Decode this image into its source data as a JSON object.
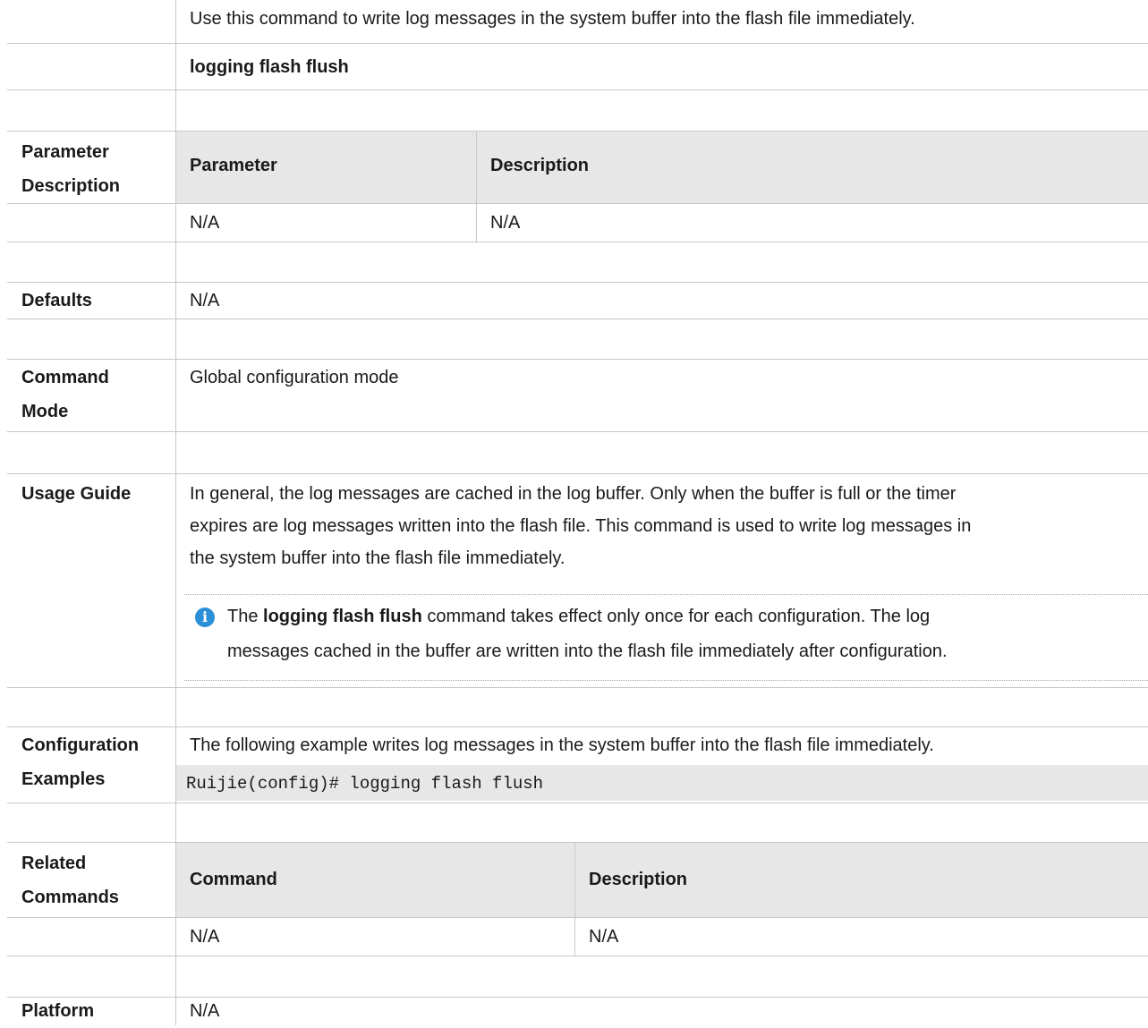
{
  "summary": {
    "description": "Use this command to write log messages in the system buffer into the flash file immediately.",
    "command": "logging flash flush"
  },
  "parameter_description": {
    "label": [
      "Parameter",
      "Description"
    ],
    "headers": [
      "Parameter",
      "Description"
    ],
    "rows": [
      [
        "N/A",
        "N/A"
      ]
    ]
  },
  "defaults": {
    "label": "Defaults",
    "value": "N/A"
  },
  "command_mode": {
    "label": [
      "Command",
      "Mode"
    ],
    "value": "Global configuration mode"
  },
  "usage_guide": {
    "label": "Usage Guide",
    "lines": [
      "In general, the log messages are cached in the log buffer. Only when the buffer is full or the timer",
      "expires are log messages written into the flash file. This command is used to write log messages in",
      "the system buffer into the flash file immediately."
    ],
    "note": {
      "icon": "info-icon",
      "prefix": "The ",
      "bold": "logging flash flush",
      "line1_rest": " command takes effect only once for each configuration. The log",
      "line2": "messages cached in the buffer are written into the flash file immediately after configuration."
    }
  },
  "configuration_examples": {
    "label": [
      "Configuration",
      "Examples"
    ],
    "description": "The following example writes log messages in the system buffer into the flash file immediately.",
    "code": "Ruijie(config)# logging flash flush"
  },
  "related_commands": {
    "label": [
      "Related",
      "Commands"
    ],
    "headers": [
      "Command",
      "Description"
    ],
    "rows": [
      [
        "N/A",
        "N/A"
      ]
    ]
  },
  "platform": {
    "label": "Platform",
    "value": "N/A"
  }
}
